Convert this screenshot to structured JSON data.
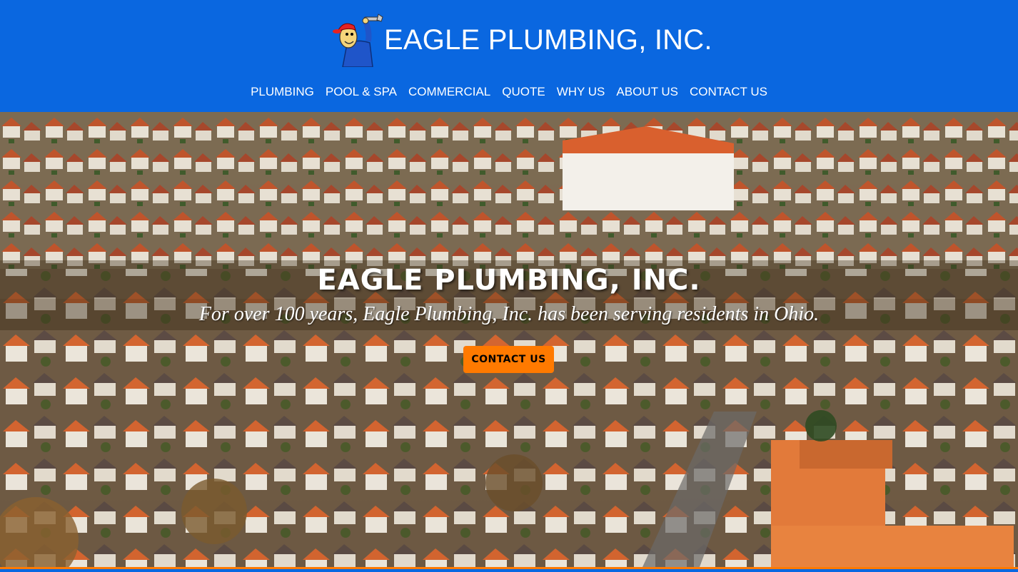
{
  "header": {
    "brand_name": "EAGLE PLUMBING, INC.",
    "logo_icon": "plumber-mascot-with-wrench-icon",
    "nav": [
      {
        "label": "PLUMBING"
      },
      {
        "label": "POOL & SPA"
      },
      {
        "label": "COMMERCIAL"
      },
      {
        "label": "QUOTE"
      },
      {
        "label": "WHY US"
      },
      {
        "label": "ABOUT US"
      },
      {
        "label": "CONTACT US"
      }
    ]
  },
  "hero": {
    "title": "EAGLE PLUMBING, INC.",
    "subtitle": "For over 100 years, Eagle Plumbing, Inc. has been serving residents in Ohio.",
    "cta_label": "CONTACT US",
    "background": "aerial-town-photo"
  },
  "colors": {
    "primary_blue": "#0a67e0",
    "accent_orange": "#ff7a00",
    "text_white": "#ffffff"
  }
}
